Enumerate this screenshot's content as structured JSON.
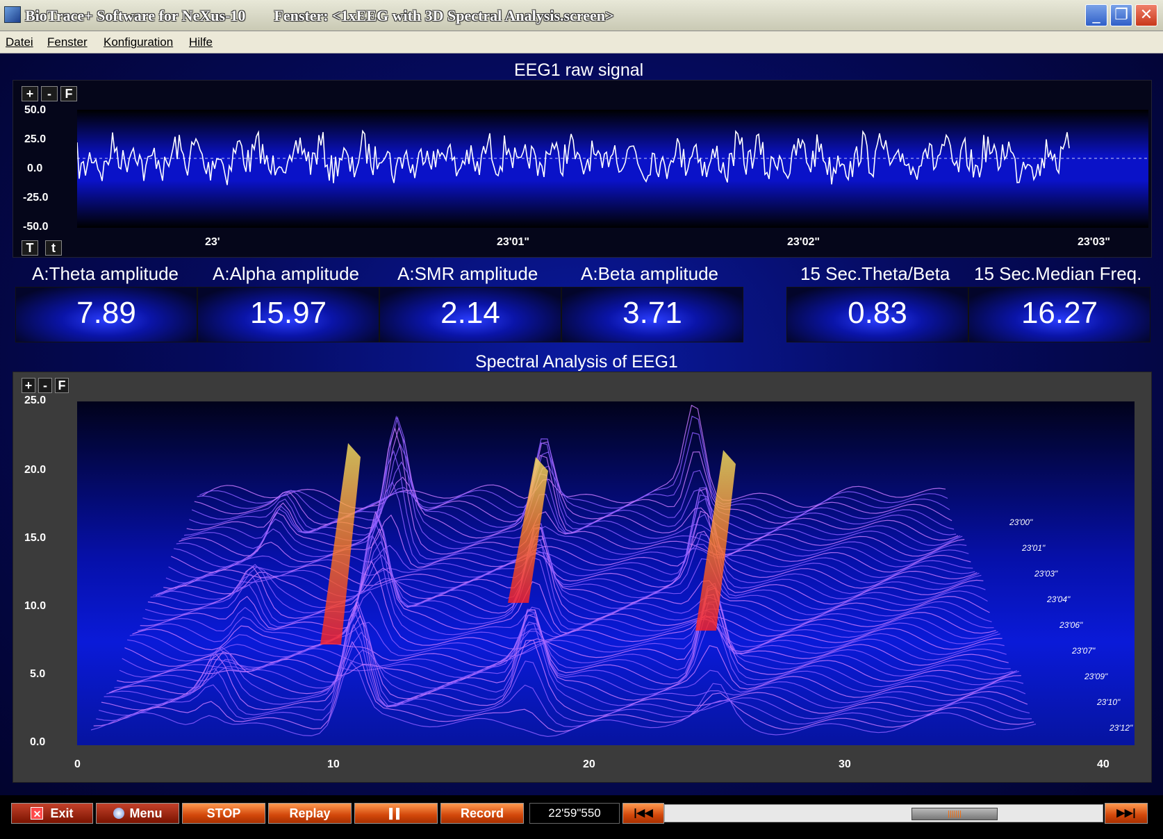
{
  "window": {
    "app_title": "BioTrace+ Software for NeXus-10",
    "screen_title": "Fenster: <1xEEG with 3D Spectral Analysis.screen>",
    "minimize": "_",
    "restore": "❐",
    "close": "✕"
  },
  "menu": {
    "items": [
      {
        "label": "Datei"
      },
      {
        "label": "Fenster"
      },
      {
        "label": "Konfiguration"
      },
      {
        "label": "Hilfe"
      }
    ]
  },
  "raw_signal": {
    "title": "EEG1 raw signal",
    "zoom_in": "+",
    "zoom_out": "-",
    "fit": "F",
    "time_big": "T",
    "time_small": "t",
    "y_ticks": [
      "50.0",
      "25.0",
      "0.0",
      "-25.0",
      "-50.0"
    ],
    "x_ticks": [
      "23'",
      "23'01\"",
      "23'02\"",
      "23'03\""
    ]
  },
  "values": [
    {
      "label": "A:Theta amplitude",
      "value": "7.89"
    },
    {
      "label": "A:Alpha amplitude",
      "value": "15.97"
    },
    {
      "label": "A:SMR amplitude",
      "value": "2.14"
    },
    {
      "label": "A:Beta amplitude",
      "value": "3.71"
    },
    {
      "label": "15 Sec.Theta/Beta",
      "value": "0.83"
    },
    {
      "label": "15 Sec.Median Freq.",
      "value": "16.27"
    }
  ],
  "spectral": {
    "title": "Spectral Analysis of EEG1",
    "zoom_in": "+",
    "zoom_out": "-",
    "fit": "F",
    "y_ticks": [
      "25.0",
      "20.0",
      "15.0",
      "10.0",
      "5.0",
      "0.0"
    ],
    "x_ticks": [
      "0",
      "10",
      "20",
      "30",
      "40"
    ],
    "time_labels": [
      "23'00\"",
      "23'01\"",
      "23'03\"",
      "23'04\"",
      "23'06\"",
      "23'07\"",
      "23'09\"",
      "23'10\"",
      "23'12\""
    ]
  },
  "toolbar": {
    "exit": "Exit",
    "menu": "Menu",
    "stop": "STOP",
    "replay": "Replay",
    "pause": "▌▌",
    "record": "Record",
    "time": "22'59\"550",
    "rewind": "|◀◀",
    "forward": "▶▶|"
  }
}
